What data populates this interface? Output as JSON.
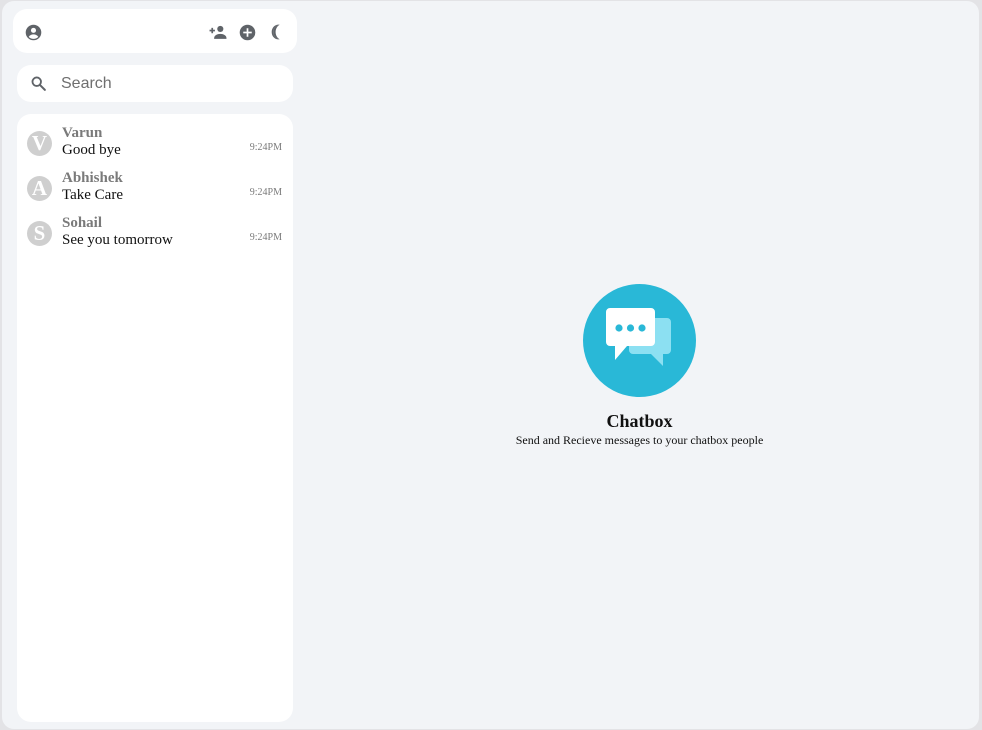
{
  "header": {
    "icons": [
      "account-circle-icon",
      "add-person-icon",
      "add-circle-icon",
      "dark-mode-moon-icon"
    ]
  },
  "search": {
    "placeholder": "Search",
    "icon": "search-icon"
  },
  "chats": [
    {
      "initial": "V",
      "name": "Varun",
      "message": "Good bye",
      "time": "9:24PM"
    },
    {
      "initial": "A",
      "name": "Abhishek",
      "message": "Take Care",
      "time": "9:24PM"
    },
    {
      "initial": "S",
      "name": "Sohail",
      "message": "See you tomorrow",
      "time": "9:24PM"
    }
  ],
  "welcome": {
    "title": "Chatbox",
    "subtitle": "Send and Recieve messages to your chatbox people",
    "logo_icon": "chat-bubbles-icon"
  },
  "colors": {
    "accent": "#29b8d7",
    "background": "#f2f4f7",
    "panel": "#ffffff",
    "avatar": "#cfcfcf"
  }
}
